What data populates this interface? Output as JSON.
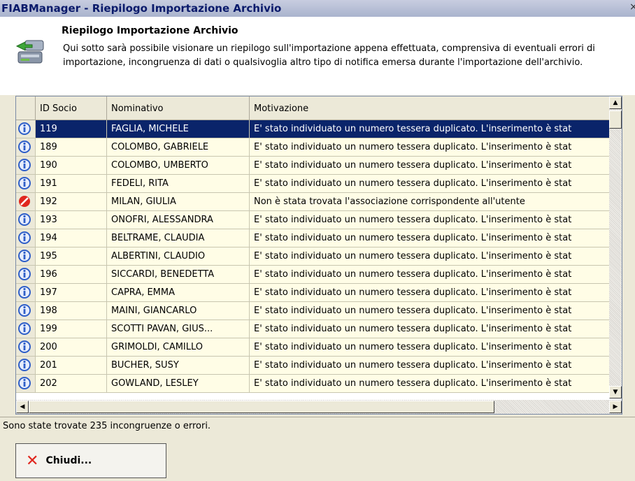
{
  "window": {
    "title": "FIABManager - Riepilogo Importazione Archivio",
    "close_glyph": "×"
  },
  "header": {
    "title": "Riepilogo Importazione Archivio",
    "description": "Qui sotto sarà possibile visionare un riepilogo sull'importazione appena effettuata, comprensiva di eventuali errori di importazione, incongruenza di dati o qualsivoglia altro tipo di notifica emersa durante l'importazione dell'archivio.",
    "icon": "import-archive-icon"
  },
  "grid": {
    "columns": [
      "",
      "ID Socio",
      "Nominativo",
      "Motivazione"
    ],
    "rows": [
      {
        "icon": "info",
        "id": "119",
        "name": "FAGLIA, MICHELE",
        "reason": "E' stato individuato un numero tessera duplicato. L'inserimento è stat",
        "selected": true
      },
      {
        "icon": "info",
        "id": "189",
        "name": "COLOMBO, GABRIELE",
        "reason": "E' stato individuato un numero tessera duplicato. L'inserimento è stat"
      },
      {
        "icon": "info",
        "id": "190",
        "name": "COLOMBO, UMBERTO",
        "reason": "E' stato individuato un numero tessera duplicato. L'inserimento è stat"
      },
      {
        "icon": "info",
        "id": "191",
        "name": "FEDELI, RITA",
        "reason": "E' stato individuato un numero tessera duplicato. L'inserimento è stat"
      },
      {
        "icon": "error",
        "id": "192",
        "name": "MILAN, GIULIA",
        "reason": "Non è stata trovata l'associazione corrispondente all'utente"
      },
      {
        "icon": "info",
        "id": "193",
        "name": "ONOFRI, ALESSANDRA",
        "reason": "E' stato individuato un numero tessera duplicato. L'inserimento è stat"
      },
      {
        "icon": "info",
        "id": "194",
        "name": "BELTRAME, CLAUDIA",
        "reason": "E' stato individuato un numero tessera duplicato. L'inserimento è stat"
      },
      {
        "icon": "info",
        "id": "195",
        "name": "ALBERTINI, CLAUDIO",
        "reason": "E' stato individuato un numero tessera duplicato. L'inserimento è stat"
      },
      {
        "icon": "info",
        "id": "196",
        "name": "SICCARDI, BENEDETTA",
        "reason": "E' stato individuato un numero tessera duplicato. L'inserimento è stat"
      },
      {
        "icon": "info",
        "id": "197",
        "name": "CAPRA, EMMA",
        "reason": "E' stato individuato un numero tessera duplicato. L'inserimento è stat"
      },
      {
        "icon": "info",
        "id": "198",
        "name": "MAINI, GIANCARLO",
        "reason": "E' stato individuato un numero tessera duplicato. L'inserimento è stat"
      },
      {
        "icon": "info",
        "id": "199",
        "name": "SCOTTI PAVAN, GIUS...",
        "reason": "E' stato individuato un numero tessera duplicato. L'inserimento è stat"
      },
      {
        "icon": "info",
        "id": "200",
        "name": "GRIMOLDI, CAMILLO",
        "reason": "E' stato individuato un numero tessera duplicato. L'inserimento è stat"
      },
      {
        "icon": "info",
        "id": "201",
        "name": "BUCHER, SUSY",
        "reason": "E' stato individuato un numero tessera duplicato. L'inserimento è stat"
      },
      {
        "icon": "info",
        "id": "202",
        "name": "GOWLAND, LESLEY",
        "reason": "E' stato individuato un numero tessera duplicato. L'inserimento è stat"
      }
    ]
  },
  "status": {
    "text": "Sono state trovate 235 incongruenze o errori."
  },
  "buttons": {
    "close_label": "Chiudi..."
  },
  "colors": {
    "selection": "#0a246a",
    "row_background": "#fffde6",
    "info_icon": "#2f5fc8",
    "error_icon": "#e0261e",
    "close_x": "#e0261e"
  }
}
